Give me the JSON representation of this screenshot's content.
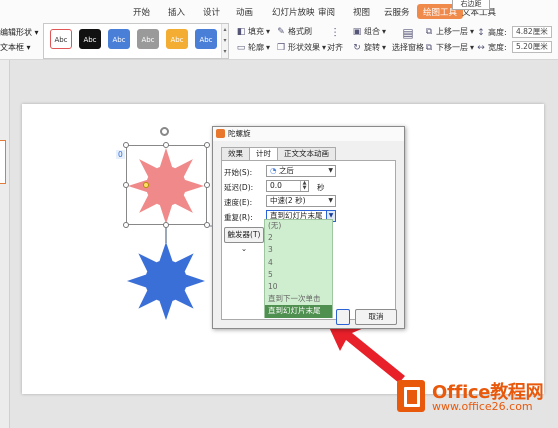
{
  "ribbon": {
    "tabs": [
      {
        "label": "开始"
      },
      {
        "label": "插入"
      },
      {
        "label": "设计"
      },
      {
        "label": "动画"
      },
      {
        "label": "幻灯片放映"
      },
      {
        "label": "审阅"
      },
      {
        "label": "视图"
      },
      {
        "label": "云服务"
      },
      {
        "label": "绘图工具"
      },
      {
        "label": "文本工具"
      }
    ],
    "active_tab": "绘图工具",
    "popup_tip": "右边距",
    "left_tools": {
      "edit_shape": "编辑形状",
      "text_box": "文本框"
    },
    "style_gallery": [
      {
        "label": "Abc",
        "fill": "#ffffff",
        "border": "#e05555",
        "text_color": "#333333"
      },
      {
        "label": "Abc",
        "fill": "#111111",
        "border": "#111111",
        "text_color": "#ffffff"
      },
      {
        "label": "Abc",
        "fill": "#4a7fd8",
        "border": "#4a7fd8",
        "text_color": "#ffffff"
      },
      {
        "label": "Abc",
        "fill": "#9a9a9a",
        "border": "#9a9a9a",
        "text_color": "#ffffff"
      },
      {
        "label": "Abc",
        "fill": "#f3ad32",
        "border": "#f3ad32",
        "text_color": "#ffffff"
      },
      {
        "label": "Abc",
        "fill": "#4a7fd8",
        "border": "#4a7fd8",
        "text_color": "#ffffff"
      }
    ],
    "tools": {
      "fill": "填充",
      "format_painter": "格式刷",
      "outline": "轮廓",
      "shape_effects": "形状效果",
      "align": "对齐",
      "group": "组合",
      "rotate": "旋转",
      "selection_pane": "选择窗格",
      "bring_forward": "上移一层",
      "send_backward": "下移一层",
      "height_label": "高度:",
      "height_value": "4.82厘米",
      "width_label": "宽度:",
      "width_value": "5.20厘米"
    }
  },
  "slide": {
    "shape_number": "0"
  },
  "dialog": {
    "title": "陀螺旋",
    "tabs": [
      {
        "label": "效果"
      },
      {
        "label": "计时"
      },
      {
        "label": "正文文本动画"
      }
    ],
    "active_tab": "计时",
    "start_label": "开始(S):",
    "start_value": "之后",
    "delay_label": "延迟(D):",
    "delay_value": "0.0",
    "delay_unit": "秒",
    "speed_label": "速度(E):",
    "speed_value": "中速(2 秒)",
    "repeat_label": "重复(R):",
    "repeat_value": "直到幻灯片末尾",
    "trigger_label": "触发器(T)",
    "cancel_label": "取消",
    "repeat_options": [
      "(无)",
      "2",
      "3",
      "4",
      "5",
      "10",
      "直到下一次单击",
      "直到幻灯片末尾"
    ],
    "repeat_selected_index": 7
  },
  "watermark": {
    "title": "Office教程网",
    "url": "www.office26.com"
  },
  "colors": {
    "accent": "#f08a4b",
    "sun_pink": "#f08a8a",
    "sun_blue": "#3b6fd8",
    "arrow_red": "#e8202a",
    "dropdown_bg": "#cfeecf",
    "dropdown_selected": "#4f8f4f"
  }
}
